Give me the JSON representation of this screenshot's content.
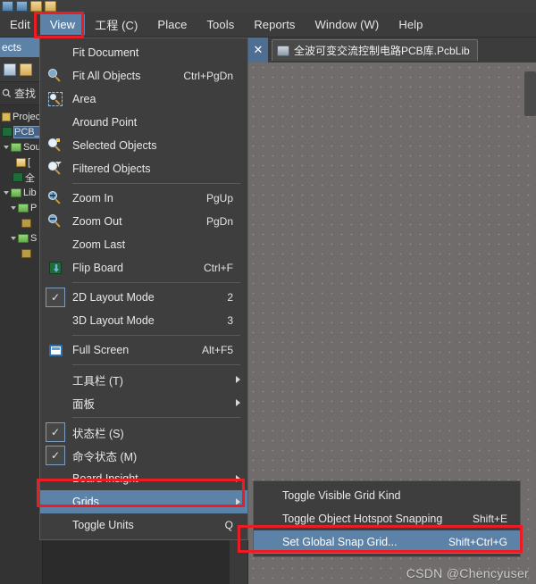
{
  "app": {
    "toolbar_icons": [
      "panel-icon",
      "save-icon",
      "open-folder-icon",
      "folder-icon"
    ]
  },
  "menubar": {
    "items": [
      {
        "label": "Edit",
        "accel": "E",
        "selected": false
      },
      {
        "label": "View",
        "accel": "V",
        "selected": true
      },
      {
        "label": "工程 (C)",
        "accel": "C",
        "selected": false
      },
      {
        "label": "Place",
        "accel": "P",
        "selected": false
      },
      {
        "label": "Tools",
        "accel": "T",
        "selected": false
      },
      {
        "label": "Reports",
        "accel": "R",
        "selected": false
      },
      {
        "label": "Window (W)",
        "accel": "W",
        "selected": false
      },
      {
        "label": "Help",
        "accel": "H",
        "selected": false
      }
    ]
  },
  "view_menu": {
    "items": [
      {
        "label": "Fit Document",
        "accel": "D",
        "shortcut": "",
        "icon": "",
        "check": false,
        "submenu": false,
        "highlighted": false
      },
      {
        "label": "Fit All Objects",
        "accel": "F",
        "shortcut": "Ctrl+PgDn",
        "icon": "zoom-fit-icon",
        "check": false,
        "submenu": false,
        "highlighted": false
      },
      {
        "label": "Area",
        "accel": "A",
        "shortcut": "",
        "icon": "zoom-area-icon",
        "check": false,
        "submenu": false,
        "highlighted": false
      },
      {
        "label": "Around Point",
        "accel": "P",
        "shortcut": "",
        "icon": "",
        "check": false,
        "submenu": false,
        "highlighted": false
      },
      {
        "label": "Selected Objects",
        "accel": "e",
        "shortcut": "",
        "icon": "zoom-selected-icon",
        "check": false,
        "submenu": false,
        "highlighted": false
      },
      {
        "label": "Filtered Objects",
        "accel": "",
        "shortcut": "",
        "icon": "zoom-filtered-icon",
        "check": false,
        "submenu": false,
        "highlighted": false
      },
      {
        "separator": true
      },
      {
        "label": "Zoom In",
        "accel": "I",
        "shortcut": "PgUp",
        "icon": "zoom-in-icon",
        "check": false,
        "submenu": false,
        "highlighted": false
      },
      {
        "label": "Zoom Out",
        "accel": "O",
        "shortcut": "PgDn",
        "icon": "zoom-out-icon",
        "check": false,
        "submenu": false,
        "highlighted": false
      },
      {
        "label": "Zoom Last",
        "accel": "Z",
        "shortcut": "",
        "icon": "",
        "check": false,
        "submenu": false,
        "highlighted": false
      },
      {
        "label": "Flip Board",
        "accel": "B",
        "shortcut": "Ctrl+F",
        "icon": "flip-board-icon",
        "check": false,
        "submenu": false,
        "highlighted": false
      },
      {
        "separator": true
      },
      {
        "label": "2D Layout Mode",
        "accel": "",
        "shortcut": "2",
        "icon": "",
        "check": true,
        "submenu": false,
        "highlighted": false
      },
      {
        "label": "3D Layout Mode",
        "accel": "",
        "shortcut": "3",
        "icon": "",
        "check": false,
        "submenu": false,
        "highlighted": false
      },
      {
        "separator": true
      },
      {
        "label": "Full Screen",
        "accel": "",
        "shortcut": "Alt+F5",
        "icon": "full-screen-icon",
        "check": false,
        "submenu": false,
        "highlighted": false
      },
      {
        "separator": true
      },
      {
        "label": "工具栏 (T)",
        "accel": "T",
        "shortcut": "",
        "icon": "",
        "check": false,
        "submenu": true,
        "highlighted": false
      },
      {
        "label": "面板",
        "accel": "",
        "shortcut": "",
        "icon": "",
        "check": false,
        "submenu": true,
        "highlighted": false
      },
      {
        "separator": true
      },
      {
        "label": "状态栏 (S)",
        "accel": "S",
        "shortcut": "",
        "icon": "",
        "check": true,
        "submenu": false,
        "highlighted": false
      },
      {
        "label": "命令状态 (M)",
        "accel": "M",
        "shortcut": "",
        "icon": "",
        "check": true,
        "submenu": false,
        "highlighted": false
      },
      {
        "label": "Board Insight",
        "accel": "",
        "shortcut": "",
        "icon": "",
        "check": false,
        "submenu": true,
        "highlighted": false
      },
      {
        "label": "Grids",
        "accel": "G",
        "shortcut": "",
        "icon": "",
        "check": false,
        "submenu": true,
        "highlighted": true
      },
      {
        "label": "Toggle Units",
        "accel": "U",
        "shortcut": "Q",
        "icon": "",
        "check": false,
        "submenu": false,
        "highlighted": false
      }
    ]
  },
  "grids_submenu": {
    "items": [
      {
        "label": "Toggle Visible Grid Kind",
        "accel": "V",
        "shortcut": "",
        "highlighted": false
      },
      {
        "label": "Toggle Object Hotspot Snapping",
        "accel": "c",
        "shortcut": "Shift+E",
        "highlighted": false
      },
      {
        "label": "Set Global Snap Grid...",
        "accel": "G",
        "shortcut": "Shift+Ctrl+G",
        "highlighted": true
      }
    ]
  },
  "left_panel": {
    "tab_label": "ects",
    "search_label": "查找",
    "tree": [
      {
        "label": "Project",
        "icon": "project-icon",
        "indent": 0,
        "expander": "",
        "selected": false
      },
      {
        "label": "PCB_",
        "icon": "pcb-icon",
        "indent": 0,
        "expander": "",
        "selected": true
      },
      {
        "label": "Sou",
        "icon": "folder-icon",
        "indent": 1,
        "expander": "down",
        "selected": false
      },
      {
        "label": "[",
        "icon": "doc-icon",
        "indent": 2,
        "expander": "",
        "selected": false
      },
      {
        "label": "全",
        "icon": "pcb-icon",
        "indent": 2,
        "expander": "",
        "selected": false
      },
      {
        "label": "Lib",
        "icon": "folder-icon",
        "indent": 1,
        "expander": "down",
        "selected": false
      },
      {
        "label": "P",
        "icon": "folder-icon",
        "indent": 2,
        "expander": "down",
        "selected": false
      },
      {
        "label": "",
        "icon": "chip-icon",
        "indent": 3,
        "expander": "",
        "selected": false
      },
      {
        "label": "S",
        "icon": "folder-icon",
        "indent": 2,
        "expander": "down",
        "selected": false
      },
      {
        "label": "",
        "icon": "chip-icon",
        "indent": 3,
        "expander": "",
        "selected": false
      }
    ]
  },
  "editor": {
    "close_label": "✕",
    "document_tab": "全波可变交流控制电路PCB库.PcbLib",
    "document_icon": "pcb-library-icon"
  },
  "watermark": "CSDN @Chencyuser",
  "colors": {
    "accent_blue": "#5d82a8",
    "highlight_red": "#ec1c24",
    "menu_bg": "#3e3e3e",
    "canvas_bg": "#6f6c6b",
    "panel_bg": "#333333"
  }
}
